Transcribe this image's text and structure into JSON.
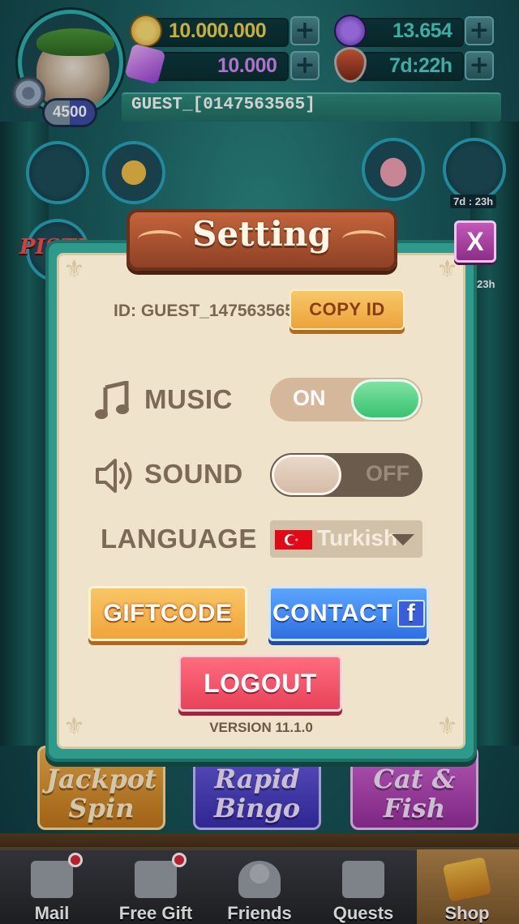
{
  "header": {
    "level": "4500",
    "player_name": "GUEST_[0147563565]",
    "coins": "10.000.000",
    "gems": "10.000",
    "energy": "13.654",
    "shield_timer": "7d:22h"
  },
  "lobby": {
    "event_timer_1": "7d : 23h",
    "event_timer_2": "23h",
    "games": [
      "Jackpot Spin",
      "Rapid Bingo",
      "Cat & Fish"
    ],
    "side_logo": "PISTI"
  },
  "settings": {
    "title": "Setting",
    "close_label": "X",
    "id_text": "ID: GUEST_147563565",
    "copy_id_label": "COPY ID",
    "music_label": "MUSIC",
    "music_state": "ON",
    "sound_label": "SOUND",
    "sound_state": "OFF",
    "language_label": "LANGUAGE",
    "language_value": "Turkish",
    "giftcode_label": "GIFTCODE",
    "contact_label": "CONTACT",
    "logout_label": "LOGOUT",
    "version": "VERSION 11.1.0"
  },
  "nav": {
    "items": [
      {
        "label": "Mail"
      },
      {
        "label": "Free Gift"
      },
      {
        "label": "Friends"
      },
      {
        "label": "Quests"
      },
      {
        "label": "Shop"
      }
    ]
  },
  "colors": {
    "modal_frame": "#2e9a8c",
    "modal_panel": "#efe3cc",
    "toggle_on": "#39c271",
    "coin": "#f5c542",
    "gem": "#c77dff",
    "energy": "#4fd1c5"
  },
  "icons": [
    "settings-gear-icon",
    "coin-icon",
    "gem-icon",
    "energy-bolt-icon",
    "shield-icon",
    "music-note-icon",
    "speaker-icon",
    "facebook-icon",
    "mail-icon",
    "gift-icon",
    "friends-icon",
    "quests-check-icon",
    "shop-cart-icon"
  ]
}
